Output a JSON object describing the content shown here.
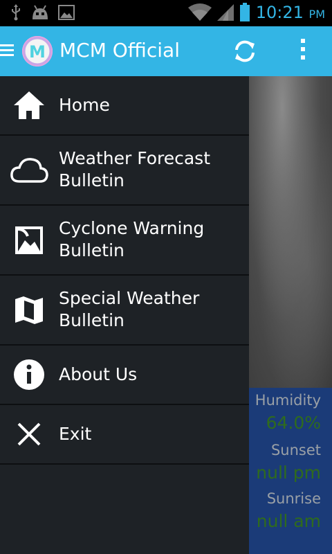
{
  "status_bar": {
    "time": "10:21",
    "ampm": "PM",
    "accent_color": "#33b5e5",
    "left_icons": [
      "usb-icon",
      "android-debug-icon",
      "image-notification-icon"
    ],
    "right_icons": [
      "wifi-icon",
      "signal-icon",
      "battery-icon"
    ]
  },
  "action_bar": {
    "title": "MCM Official",
    "background_color": "#33b5e5",
    "logo_letter": "M",
    "buttons": [
      "refresh-icon",
      "overflow-menu-icon"
    ]
  },
  "drawer": {
    "items": [
      {
        "label": "Home",
        "icon": "home-icon"
      },
      {
        "label": "Weather Forecast Bulletin",
        "line1": "Weather Forecast",
        "line2": "Bulletin",
        "icon": "cloud-icon"
      },
      {
        "label": "Cyclone Warning Bulletin",
        "line1": "Cyclone Warning",
        "line2": "Bulletin",
        "icon": "image-icon"
      },
      {
        "label": "Special Weather Bulletin",
        "line1": "Special Weather",
        "line2": "Bulletin",
        "icon": "map-icon"
      },
      {
        "label": "About Us",
        "icon": "info-icon"
      },
      {
        "label": "Exit",
        "icon": "close-icon"
      }
    ]
  },
  "weather": {
    "humidity_label": "Humidity",
    "humidity_value": "64.0%",
    "sunset_label": "Sunset",
    "sunset_value": "null pm",
    "sunrise_label": "Sunrise",
    "sunrise_value": "null am",
    "panel_color": "#1b3b78",
    "value_color": "#2f6b1d"
  }
}
